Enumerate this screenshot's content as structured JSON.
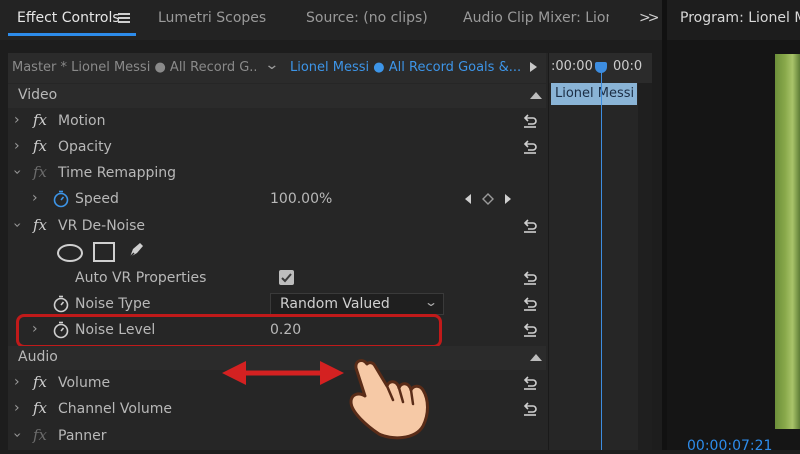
{
  "tabs": [
    {
      "label": "Effect Controls",
      "active": true
    },
    {
      "label": "Lumetri Scopes"
    },
    {
      "label": "Source: (no clips)"
    },
    {
      "label": "Audio Clip Mixer: Lione"
    }
  ],
  "overflow_label": ">>",
  "program": {
    "title": "Program: Lionel M",
    "timecode": "00:00:07:21"
  },
  "clipbar": {
    "master": "Master * Lionel Messi ● All Record G...",
    "clip": "Lionel Messi ● All Record Goals &..."
  },
  "timeline": {
    "ruler_left": ":00:00",
    "ruler_right": "00:0",
    "clip_label": "Lionel Messi"
  },
  "sections": {
    "video": "Video",
    "audio": "Audio"
  },
  "effects": {
    "motion": "Motion",
    "opacity": "Opacity",
    "time_remapping": "Time Remapping",
    "speed": {
      "label": "Speed",
      "value": "100.00%"
    },
    "vr_denoise": "VR De-Noise",
    "auto_vr": {
      "label": "Auto VR Properties",
      "checked": true
    },
    "noise_type": {
      "label": "Noise Type",
      "value": "Random Valued"
    },
    "noise_level": {
      "label": "Noise Level",
      "value": "0.20"
    },
    "volume": "Volume",
    "channel_volume": "Channel Volume",
    "panner": "Panner"
  },
  "colors": {
    "accent": "#2d8ceb",
    "highlight": "#c01a1a",
    "arrow": "#d42121"
  }
}
